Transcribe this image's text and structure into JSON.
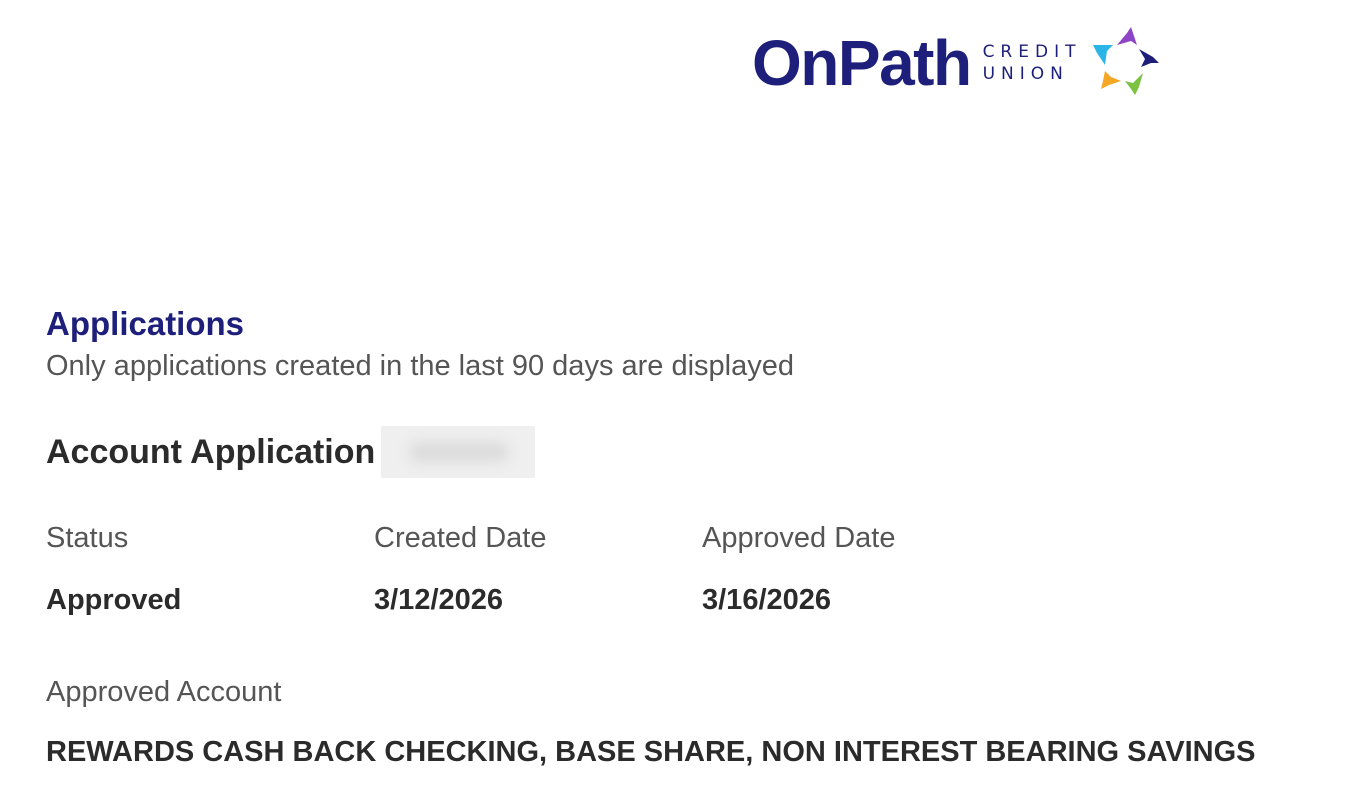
{
  "logo": {
    "word": "OnPath",
    "sub_line1": "CREDIT",
    "sub_line2": "UNION",
    "colors": [
      "#8e44c6",
      "#1d1f7a",
      "#7dc242",
      "#f5a623",
      "#29b6e6"
    ]
  },
  "applications": {
    "title": "Applications",
    "note": "Only applications created in the last 90 days are displayed"
  },
  "application": {
    "title": "Account Application",
    "status_label": "Status",
    "status_value": "Approved",
    "created_label": "Created Date",
    "created_value": "3/12/2026",
    "approved_label": "Approved Date",
    "approved_value": "3/16/2026",
    "account_label": "Approved Account",
    "account_value": "REWARDS CASH BACK CHECKING, BASE SHARE, NON INTEREST BEARING SAVINGS"
  }
}
